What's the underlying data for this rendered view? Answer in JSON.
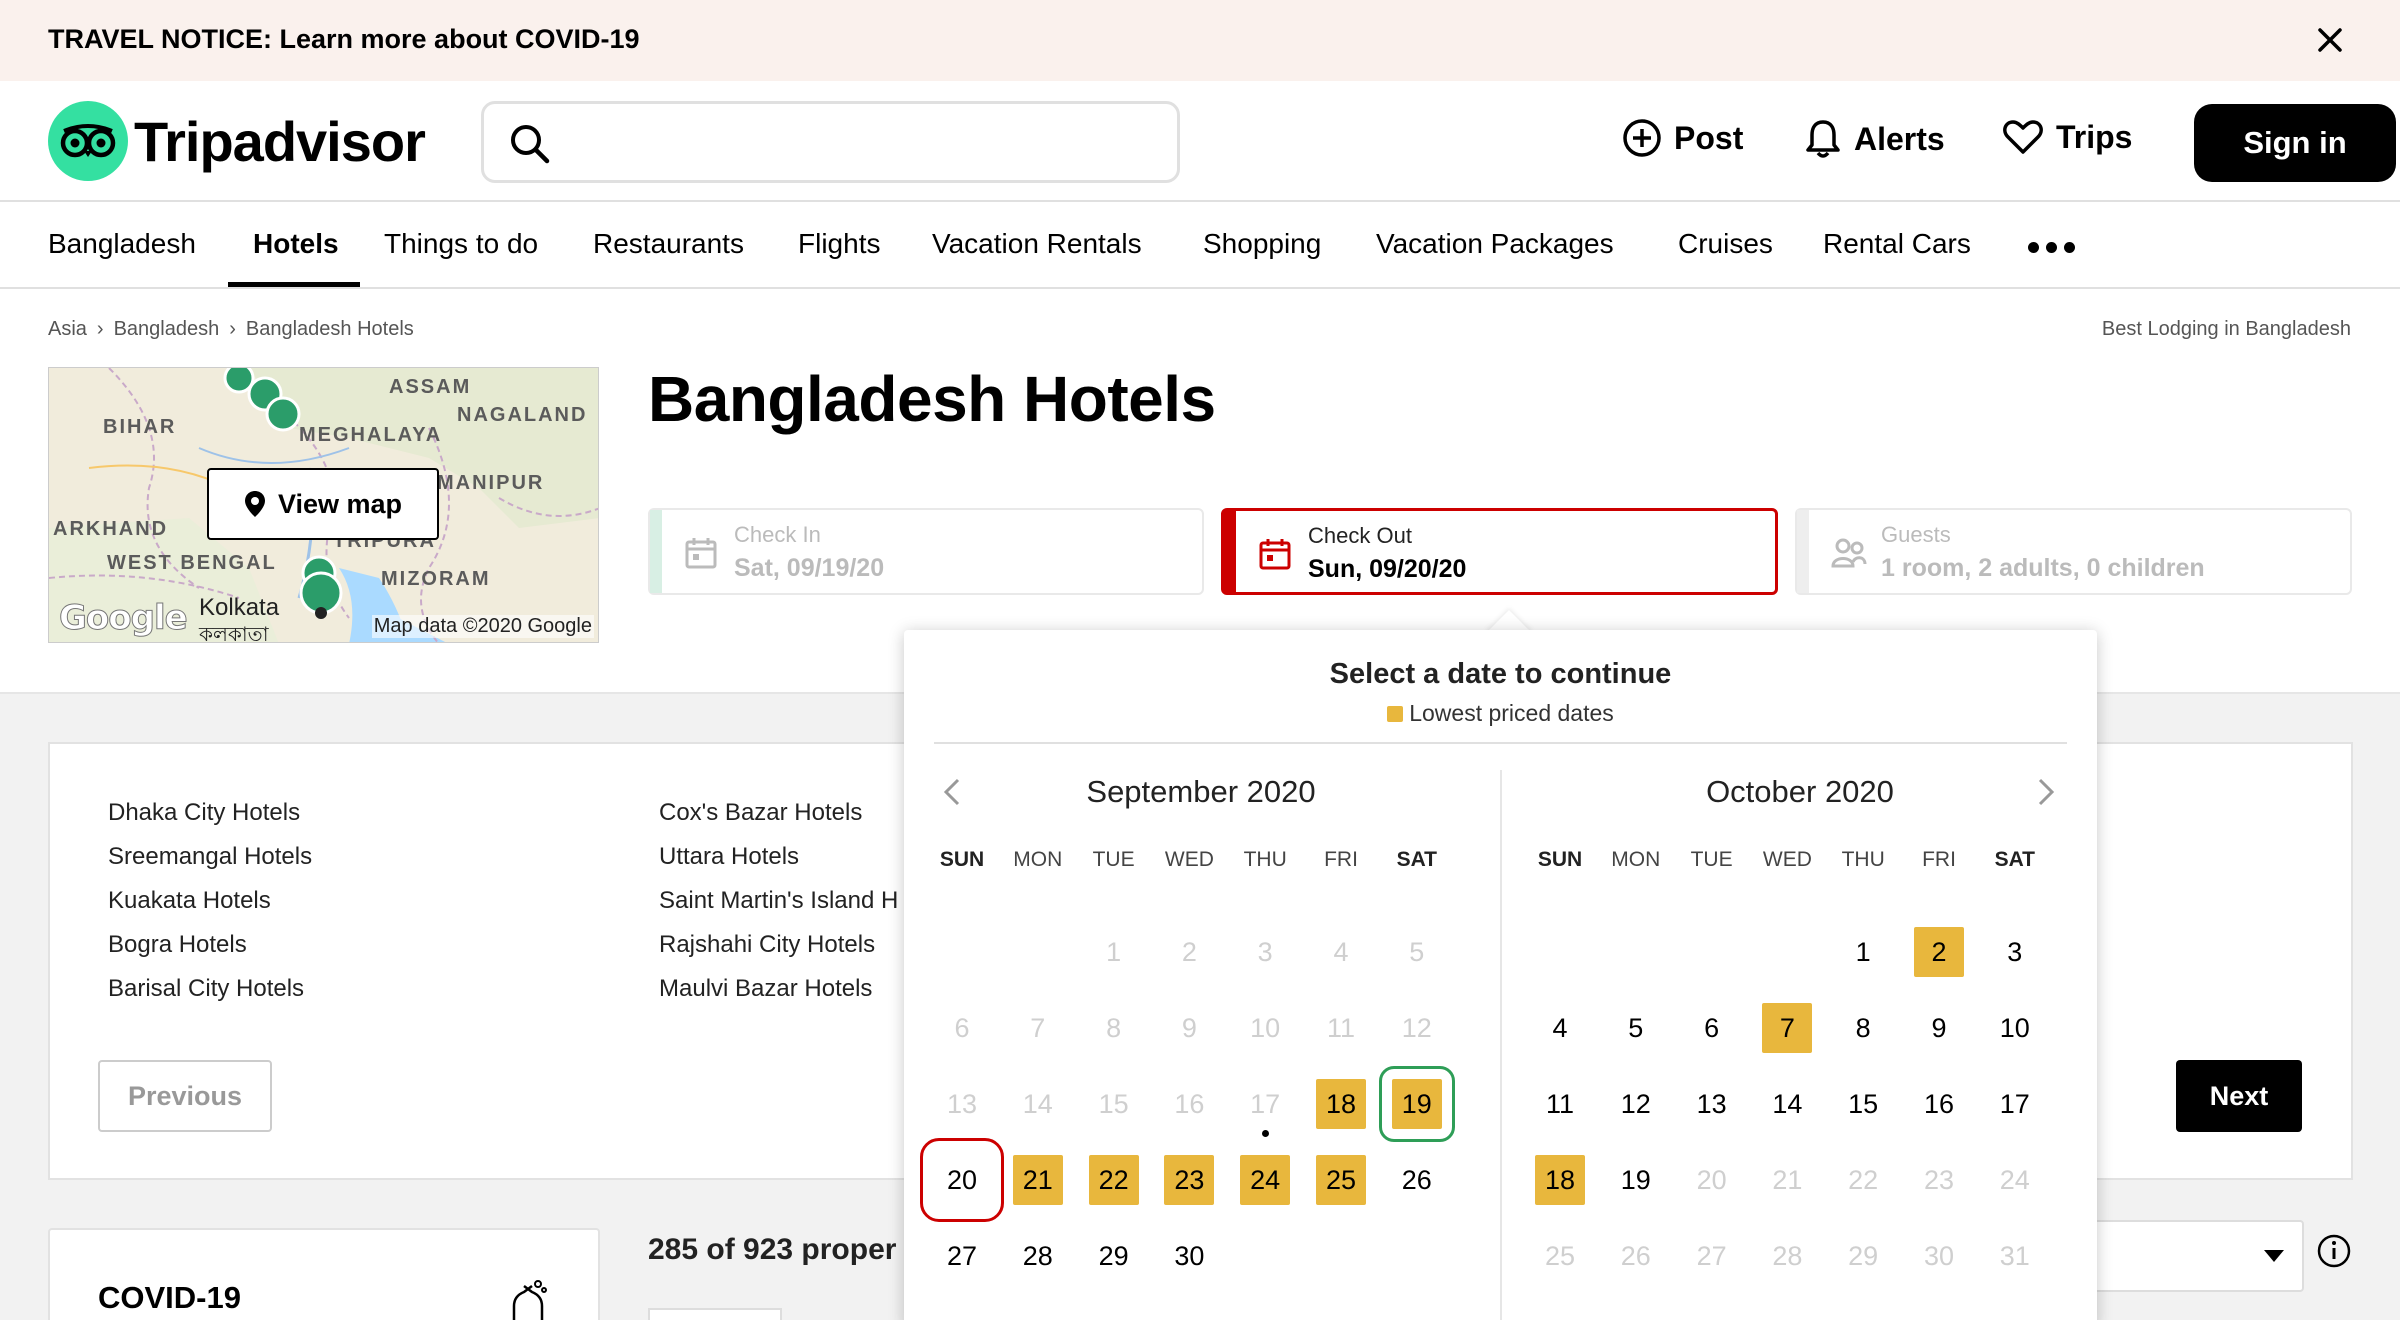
{
  "notice": {
    "label": "TRAVEL NOTICE:",
    "text": "TRAVEL NOTICE: Learn more about COVID-19"
  },
  "header": {
    "logo_text": "Tripadvisor",
    "search_placeholder": "",
    "post": "Post",
    "alerts": "Alerts",
    "trips": "Trips",
    "sign_in": "Sign in"
  },
  "nav": {
    "items": [
      "Bangladesh",
      "Hotels",
      "Things to do",
      "Restaurants",
      "Flights",
      "Vacation Rentals",
      "Shopping",
      "Vacation Packages",
      "Cruises",
      "Rental Cars"
    ],
    "active": "Hotels"
  },
  "breadcrumbs": [
    "Asia",
    "Bangladesh",
    "Bangladesh Hotels"
  ],
  "best_lodging": "Best Lodging in Bangladesh",
  "map": {
    "labels": [
      "ASSAM",
      "NAGALAND",
      "BIHAR",
      "MEGHALAYA",
      "MANIPUR",
      "ARKHAND",
      "TRIPURA",
      "WEST BENGAL",
      "MIZORAM"
    ],
    "city": "Kolkata",
    "city_local": "কলকাতা",
    "view_map": "View map",
    "credit": "Map data ©2020 Google",
    "google": "Google"
  },
  "title": "Bangladesh Hotels",
  "pickers": {
    "check_in": {
      "label": "Check In",
      "value": "Sat, 09/19/20"
    },
    "check_out": {
      "label": "Check Out",
      "value": "Sun, 09/20/20"
    },
    "guests": {
      "label": "Guests",
      "value": "1 room, 2 adults, 0 children"
    }
  },
  "city_links": {
    "col1": [
      "Dhaka City Hotels",
      "Sreemangal Hotels",
      "Kuakata Hotels",
      "Bogra Hotels",
      "Barisal City Hotels"
    ],
    "col2": [
      "Cox's Bazar Hotels",
      "Uttara Hotels",
      "Saint Martin's Island H",
      "Rajshahi City Hotels",
      "Maulvi Bazar Hotels"
    ]
  },
  "buttons": {
    "previous": "Previous",
    "next": "Next"
  },
  "covid_card_title": "COVID-19",
  "results_count": "285 of 923 proper",
  "calendar": {
    "heading": "Select a date to continue",
    "legend": "Lowest priced dates",
    "legend_color": "#e8b73d",
    "weekdays": [
      "SUN",
      "MON",
      "TUE",
      "WED",
      "THU",
      "FRI",
      "SAT"
    ],
    "months": [
      {
        "title": "September 2020",
        "first_weekday": 2,
        "days": 30,
        "disabled_through": 17,
        "lowest": [
          18,
          19,
          21,
          22,
          23,
          24,
          25
        ],
        "check_in": 19,
        "check_out": 20,
        "today": 17
      },
      {
        "title": "October 2020",
        "first_weekday": 4,
        "days": 31,
        "disabled_from": 20,
        "lowest": [
          2,
          7,
          18
        ]
      }
    ]
  },
  "colors": {
    "accent_green": "#34e0a1",
    "error_red": "#cc0000",
    "brand_black": "#000000"
  }
}
